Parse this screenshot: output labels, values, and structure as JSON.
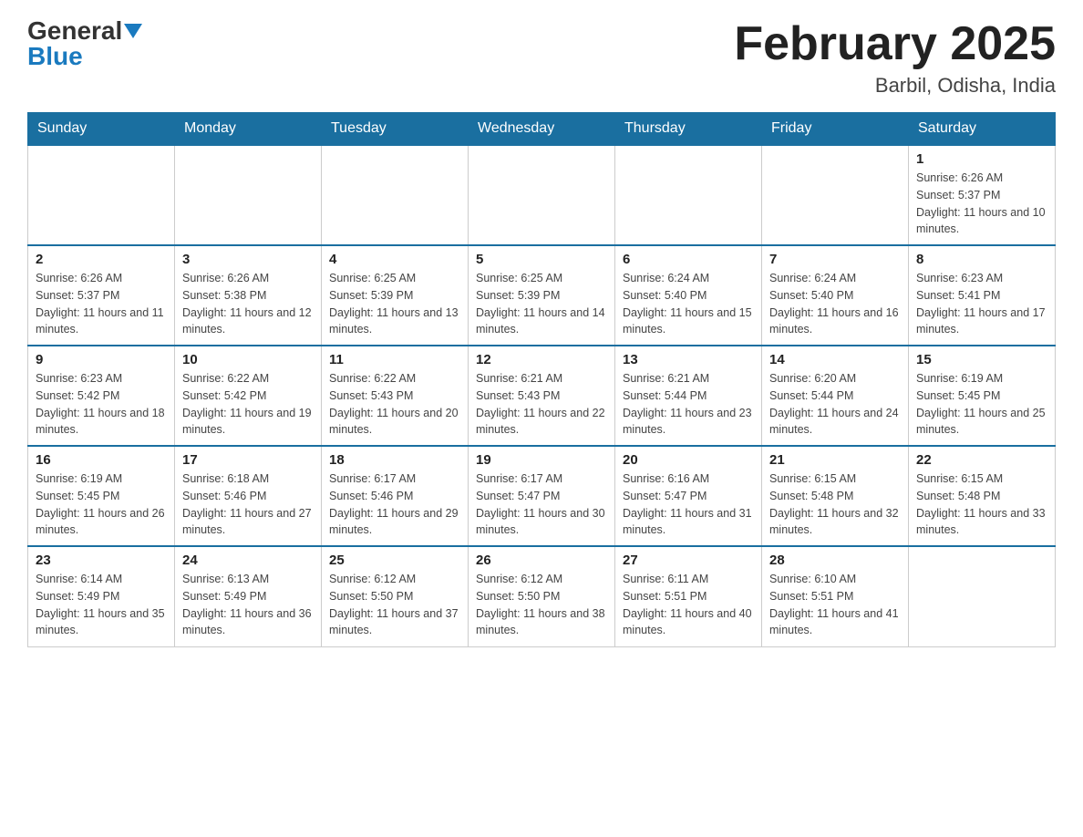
{
  "logo": {
    "general": "General",
    "blue": "Blue"
  },
  "header": {
    "title": "February 2025",
    "subtitle": "Barbil, Odisha, India"
  },
  "weekdays": [
    "Sunday",
    "Monday",
    "Tuesday",
    "Wednesday",
    "Thursday",
    "Friday",
    "Saturday"
  ],
  "weeks": [
    [
      {
        "day": "",
        "info": ""
      },
      {
        "day": "",
        "info": ""
      },
      {
        "day": "",
        "info": ""
      },
      {
        "day": "",
        "info": ""
      },
      {
        "day": "",
        "info": ""
      },
      {
        "day": "",
        "info": ""
      },
      {
        "day": "1",
        "info": "Sunrise: 6:26 AM\nSunset: 5:37 PM\nDaylight: 11 hours and 10 minutes."
      }
    ],
    [
      {
        "day": "2",
        "info": "Sunrise: 6:26 AM\nSunset: 5:37 PM\nDaylight: 11 hours and 11 minutes."
      },
      {
        "day": "3",
        "info": "Sunrise: 6:26 AM\nSunset: 5:38 PM\nDaylight: 11 hours and 12 minutes."
      },
      {
        "day": "4",
        "info": "Sunrise: 6:25 AM\nSunset: 5:39 PM\nDaylight: 11 hours and 13 minutes."
      },
      {
        "day": "5",
        "info": "Sunrise: 6:25 AM\nSunset: 5:39 PM\nDaylight: 11 hours and 14 minutes."
      },
      {
        "day": "6",
        "info": "Sunrise: 6:24 AM\nSunset: 5:40 PM\nDaylight: 11 hours and 15 minutes."
      },
      {
        "day": "7",
        "info": "Sunrise: 6:24 AM\nSunset: 5:40 PM\nDaylight: 11 hours and 16 minutes."
      },
      {
        "day": "8",
        "info": "Sunrise: 6:23 AM\nSunset: 5:41 PM\nDaylight: 11 hours and 17 minutes."
      }
    ],
    [
      {
        "day": "9",
        "info": "Sunrise: 6:23 AM\nSunset: 5:42 PM\nDaylight: 11 hours and 18 minutes."
      },
      {
        "day": "10",
        "info": "Sunrise: 6:22 AM\nSunset: 5:42 PM\nDaylight: 11 hours and 19 minutes."
      },
      {
        "day": "11",
        "info": "Sunrise: 6:22 AM\nSunset: 5:43 PM\nDaylight: 11 hours and 20 minutes."
      },
      {
        "day": "12",
        "info": "Sunrise: 6:21 AM\nSunset: 5:43 PM\nDaylight: 11 hours and 22 minutes."
      },
      {
        "day": "13",
        "info": "Sunrise: 6:21 AM\nSunset: 5:44 PM\nDaylight: 11 hours and 23 minutes."
      },
      {
        "day": "14",
        "info": "Sunrise: 6:20 AM\nSunset: 5:44 PM\nDaylight: 11 hours and 24 minutes."
      },
      {
        "day": "15",
        "info": "Sunrise: 6:19 AM\nSunset: 5:45 PM\nDaylight: 11 hours and 25 minutes."
      }
    ],
    [
      {
        "day": "16",
        "info": "Sunrise: 6:19 AM\nSunset: 5:45 PM\nDaylight: 11 hours and 26 minutes."
      },
      {
        "day": "17",
        "info": "Sunrise: 6:18 AM\nSunset: 5:46 PM\nDaylight: 11 hours and 27 minutes."
      },
      {
        "day": "18",
        "info": "Sunrise: 6:17 AM\nSunset: 5:46 PM\nDaylight: 11 hours and 29 minutes."
      },
      {
        "day": "19",
        "info": "Sunrise: 6:17 AM\nSunset: 5:47 PM\nDaylight: 11 hours and 30 minutes."
      },
      {
        "day": "20",
        "info": "Sunrise: 6:16 AM\nSunset: 5:47 PM\nDaylight: 11 hours and 31 minutes."
      },
      {
        "day": "21",
        "info": "Sunrise: 6:15 AM\nSunset: 5:48 PM\nDaylight: 11 hours and 32 minutes."
      },
      {
        "day": "22",
        "info": "Sunrise: 6:15 AM\nSunset: 5:48 PM\nDaylight: 11 hours and 33 minutes."
      }
    ],
    [
      {
        "day": "23",
        "info": "Sunrise: 6:14 AM\nSunset: 5:49 PM\nDaylight: 11 hours and 35 minutes."
      },
      {
        "day": "24",
        "info": "Sunrise: 6:13 AM\nSunset: 5:49 PM\nDaylight: 11 hours and 36 minutes."
      },
      {
        "day": "25",
        "info": "Sunrise: 6:12 AM\nSunset: 5:50 PM\nDaylight: 11 hours and 37 minutes."
      },
      {
        "day": "26",
        "info": "Sunrise: 6:12 AM\nSunset: 5:50 PM\nDaylight: 11 hours and 38 minutes."
      },
      {
        "day": "27",
        "info": "Sunrise: 6:11 AM\nSunset: 5:51 PM\nDaylight: 11 hours and 40 minutes."
      },
      {
        "day": "28",
        "info": "Sunrise: 6:10 AM\nSunset: 5:51 PM\nDaylight: 11 hours and 41 minutes."
      },
      {
        "day": "",
        "info": ""
      }
    ]
  ]
}
